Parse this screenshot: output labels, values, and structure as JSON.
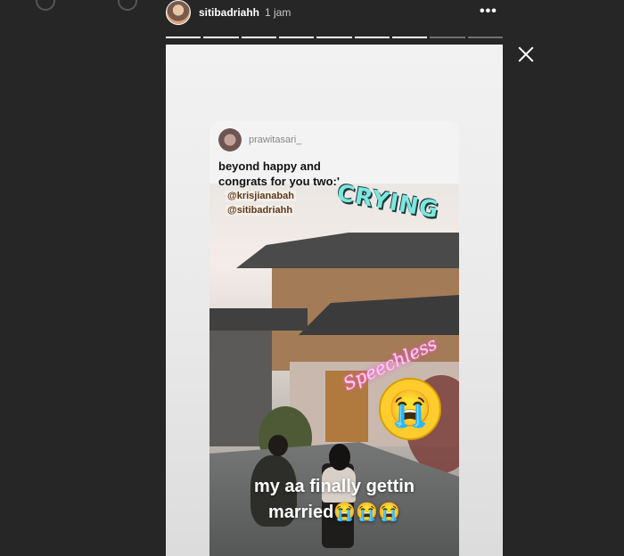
{
  "header": {
    "username": "sitibadriahh",
    "time": "1 jam",
    "more": "•••"
  },
  "progress": {
    "segments": 9,
    "completed": 7
  },
  "repost": {
    "poster": "prawitasari_",
    "quote_line1": "beyond happy and",
    "quote_line2": "congrats for you two:'",
    "mention1": "@krisjianabah",
    "mention2": "@sitibadriahh"
  },
  "stickers": {
    "crying": "CRYING",
    "speechless": "Speechless",
    "emoji": "😭"
  },
  "caption": {
    "line1": "my aa finally gettin",
    "line2": "married😭😭😭"
  }
}
